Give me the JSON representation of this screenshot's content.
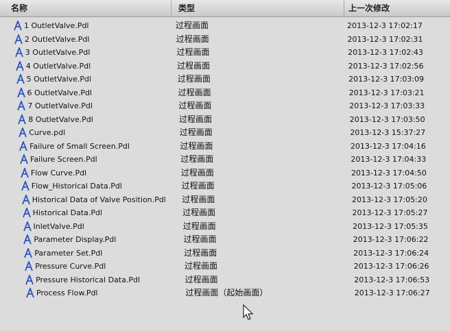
{
  "columns": {
    "name": "名称",
    "type": "类型",
    "modified": "上一次修改"
  },
  "files": [
    {
      "name": "1 OutletValve.Pdl",
      "type": "过程画面",
      "modified": "2013-12-3 17:02:17"
    },
    {
      "name": "2 OutletValve.Pdl",
      "type": "过程画面",
      "modified": "2013-12-3 17:02:31"
    },
    {
      "name": "3 OutletValve.Pdl",
      "type": "过程画面",
      "modified": "2013-12-3 17:02:43"
    },
    {
      "name": "4 OutletValve.Pdl",
      "type": "过程画面",
      "modified": "2013-12-3 17:02:56"
    },
    {
      "name": "5 OutletValve.Pdl",
      "type": "过程画面",
      "modified": "2013-12-3 17:03:09"
    },
    {
      "name": "6 OutletValve.Pdl",
      "type": "过程画面",
      "modified": "2013-12-3 17:03:21"
    },
    {
      "name": "7 OutletValve.Pdl",
      "type": "过程画面",
      "modified": "2013-12-3 17:03:33"
    },
    {
      "name": "8 OutletValve.Pdl",
      "type": "过程画面",
      "modified": "2013-12-3 17:03:50"
    },
    {
      "name": "Curve.pdl",
      "type": "过程画面",
      "modified": "2013-12-3 15:37:27"
    },
    {
      "name": "Failure of Small Screen.Pdl",
      "type": "过程画面",
      "modified": "2013-12-3 17:04:16"
    },
    {
      "name": "Failure Screen.Pdl",
      "type": "过程画面",
      "modified": "2013-12-3 17:04:33"
    },
    {
      "name": "Flow Curve.Pdl",
      "type": "过程画面",
      "modified": "2013-12-3 17:04:50"
    },
    {
      "name": "Flow_Historical Data.Pdl",
      "type": "过程画面",
      "modified": "2013-12-3 17:05:06"
    },
    {
      "name": "Historical Data of Valve Position.Pdl",
      "type": "过程画面",
      "modified": "2013-12-3 17:05:20"
    },
    {
      "name": "Historical Data.Pdl",
      "type": "过程画面",
      "modified": "2013-12-3 17:05:27"
    },
    {
      "name": "InletValve.Pdl",
      "type": "过程画面",
      "modified": "2013-12-3 17:05:35"
    },
    {
      "name": "Parameter Display.Pdl",
      "type": "过程画面",
      "modified": "2013-12-3 17:06:22"
    },
    {
      "name": "Parameter Set.Pdl",
      "type": "过程画面",
      "modified": "2013-12-3 17:06:24"
    },
    {
      "name": "Pressure Curve.Pdl",
      "type": "过程画面",
      "modified": "2013-12-3 17:06:26"
    },
    {
      "name": "Pressure Historical Data.Pdl",
      "type": "过程画面",
      "modified": "2013-12-3 17:06:53"
    },
    {
      "name": "Process Flow.Pdl",
      "type": "过程画面（起始画面）",
      "modified": "2013-12-3 17:06:27"
    }
  ],
  "icons": {
    "file": "pdl-file-icon",
    "cursor": "mouse-cursor-icon"
  },
  "colors": {
    "icon": "#2a56c6",
    "background": "#dcdcdc"
  }
}
